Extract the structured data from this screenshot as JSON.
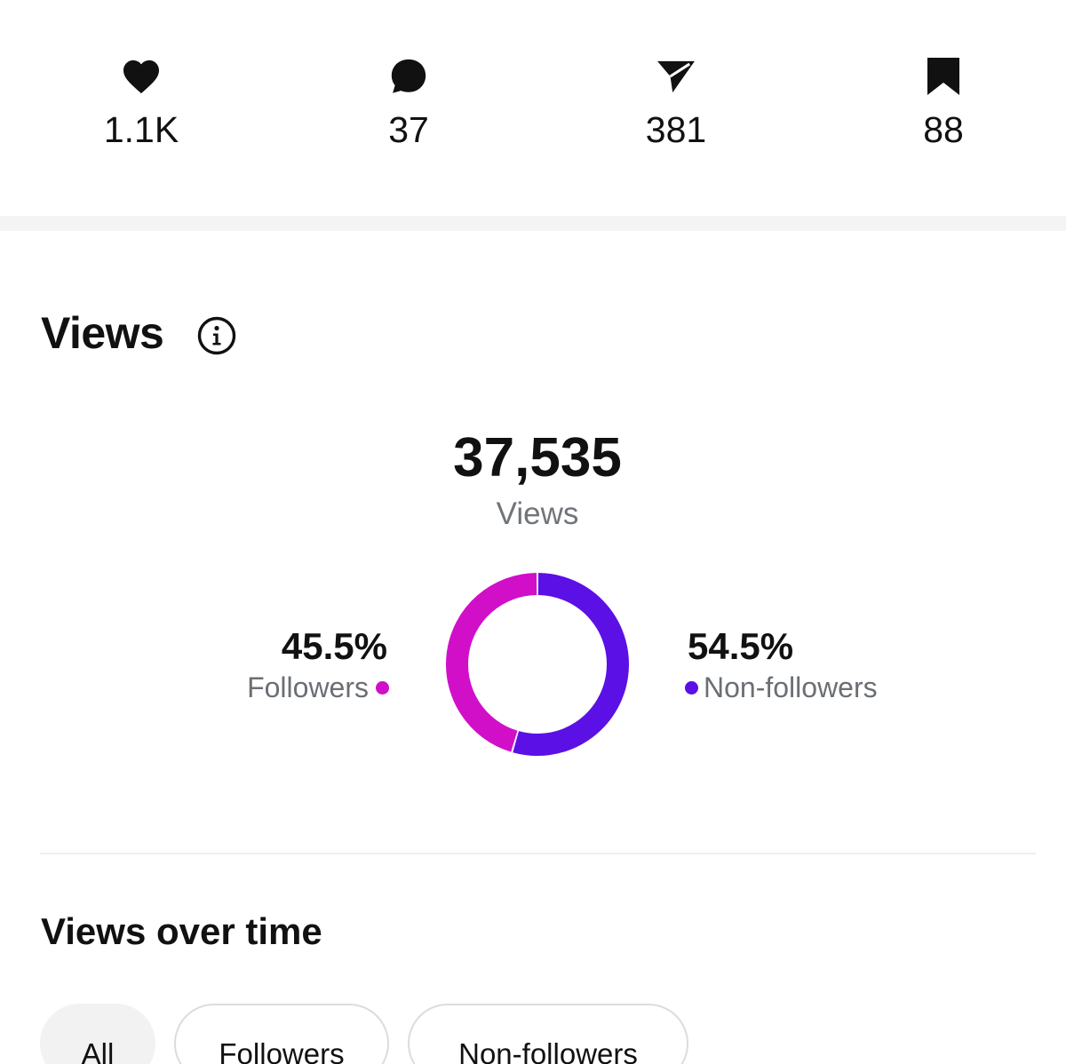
{
  "stats": [
    {
      "icon": "heart-icon",
      "value": "1.1K"
    },
    {
      "icon": "comment-icon",
      "value": "37"
    },
    {
      "icon": "send-icon",
      "value": "381"
    },
    {
      "icon": "bookmark-icon",
      "value": "88"
    }
  ],
  "views": {
    "title": "Views",
    "info_icon": "info-icon",
    "total": "37,535",
    "total_label": "Views",
    "followers": {
      "percent": "45.5%",
      "label": "Followers",
      "color": "#d10fc8",
      "share": 45.5
    },
    "non_followers": {
      "percent": "54.5%",
      "label": "Non-followers",
      "color": "#5b10e6",
      "share": 54.5
    }
  },
  "views_over_time": {
    "title": "Views over time",
    "filters": [
      {
        "label": "All",
        "active": true
      },
      {
        "label": "Followers",
        "active": false
      },
      {
        "label": "Non-followers",
        "active": false
      }
    ]
  },
  "chart_data": {
    "type": "pie",
    "categories": [
      "Followers",
      "Non-followers"
    ],
    "values": [
      45.5,
      54.5
    ],
    "colors": [
      "#d10fc8",
      "#5b10e6"
    ],
    "title": "",
    "center_value": "37,535",
    "center_label": "Views"
  }
}
